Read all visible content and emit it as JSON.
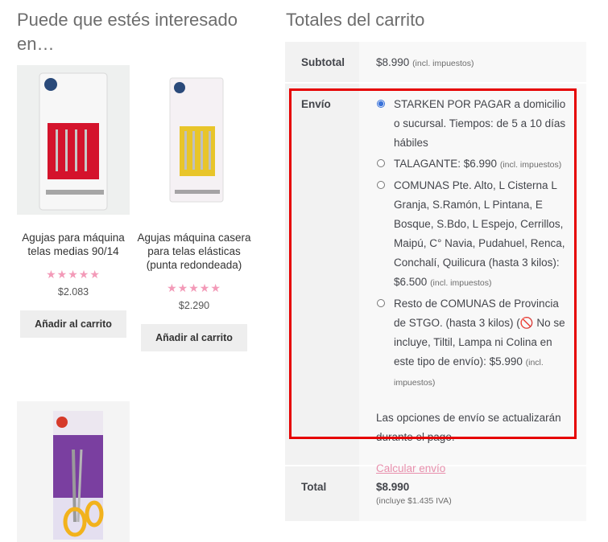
{
  "related": {
    "title": "Puede que estés interesado en…",
    "products": [
      {
        "name": "Agujas para máquina telas medias 90/14",
        "rating": "★★★★★",
        "price": "$2.083",
        "button": "Añadir al carrito"
      },
      {
        "name": "Agujas máquina casera para telas elásticas (punta redondeada)",
        "rating": "★★★★★",
        "price": "$2.290",
        "button": "Añadir al carrito"
      }
    ]
  },
  "totals": {
    "title": "Totales del carrito",
    "subtotal_label": "Subtotal",
    "subtotal_value": "$8.990",
    "subtotal_tax": "(incl. impuestos)",
    "shipping_label": "Envío",
    "options": [
      {
        "text": "STARKEN POR PAGAR a domicilio o sucursal. Tiempos: de 5 a 10 días hábiles",
        "tax": "",
        "checked": true
      },
      {
        "text": "TALAGANTE: $6.990",
        "tax": "(incl. impuestos)",
        "checked": false
      },
      {
        "text": "COMUNAS Pte. Alto, L Cisterna L Granja, S.Ramón, L Pintana, E Bosque, S.Bdo, L Espejo, Cerrillos, Maipú, C° Navia, Pudahuel, Renca, Conchalí, Quilicura (hasta 3 kilos): $6.500",
        "tax": "(incl. impuestos)",
        "checked": false
      },
      {
        "text_before": "Resto de COMUNAS de Provincia de STGO. (hasta 3 kilos) (",
        "text_after": " No se incluye, Tiltil, Lampa ni Colina en este tipo de envío): $5.990",
        "tax": "(incl. impuestos)",
        "checked": false
      }
    ],
    "shipping_note": "Las opciones de envío se actualizarán durante el pago.",
    "calc_link": "Calcular envío",
    "total_label": "Total",
    "total_value": "$8.990",
    "total_tax": "(incluye $1.435 IVA)"
  },
  "colors": {
    "highlight": "#e60000",
    "stars": "#f39ab8",
    "link": "#e890ad",
    "radio": "#3b73d9"
  }
}
